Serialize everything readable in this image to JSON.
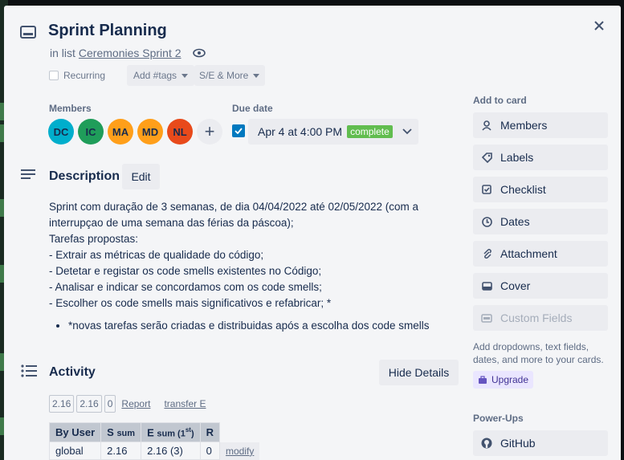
{
  "card": {
    "title": "Sprint Planning",
    "in_list_prefix": "in list",
    "list_name": "Ceremonies Sprint 2"
  },
  "toolbar": {
    "recurring_label": "Recurring",
    "tags_label": "Add #tags",
    "se_label": "S/E & More"
  },
  "members": {
    "label": "Members",
    "avatars": [
      {
        "initials": "DC",
        "color": "#00aecc"
      },
      {
        "initials": "IC",
        "color": "#1f9d5a"
      },
      {
        "initials": "MA",
        "color": "#ff9f1a"
      },
      {
        "initials": "MD",
        "color": "#ff9f1a"
      },
      {
        "initials": "NL",
        "color": "#e84a1b"
      }
    ],
    "add_label": "+"
  },
  "due": {
    "label": "Due date",
    "value": "Apr 4 at 4:00 PM",
    "badge": "complete",
    "checked": true
  },
  "description": {
    "title": "Description",
    "edit_label": "Edit",
    "lines": [
      "Sprint com duração de 3 semanas, de dia 04/04/2022 até 02/05/2022 (com a interrupçao de uma semana das férias da páscoa);",
      "Tarefas propostas:",
      "- Extrair as métricas de qualidade do código;",
      "- Detetar e registar os code smells existentes no Código;",
      "- Analisar e indicar se concordamos com os code smells;",
      "- Escolher os code smells mais significativos e refabricar; *"
    ],
    "bullet": "*novas tarefas serão criadas e distribuidas após a escolha dos code smells"
  },
  "activity": {
    "title": "Activity",
    "hide_label": "Hide Details",
    "plus_values": [
      "2.16",
      "2.16",
      "0"
    ],
    "report_label": "Report",
    "transfer_label": "transfer E",
    "table": {
      "headers": [
        "By User",
        "S sum",
        "E sum (1st)",
        "R"
      ],
      "header_parts": {
        "s_main": "S",
        "s_sub": "sum",
        "e_main": "E",
        "e_sub": "sum (1",
        "e_sup": "st",
        "e_end": ")"
      },
      "rows": [
        [
          "global",
          "2.16",
          "2.16 (3)",
          "0"
        ]
      ],
      "modify_label": "modify"
    }
  },
  "sidebar": {
    "add_to_card_label": "Add to card",
    "buttons": [
      {
        "label": "Members",
        "icon": "person-icon"
      },
      {
        "label": "Labels",
        "icon": "tag-icon"
      },
      {
        "label": "Checklist",
        "icon": "checklist-icon"
      },
      {
        "label": "Dates",
        "icon": "clock-icon"
      },
      {
        "label": "Attachment",
        "icon": "paperclip-icon"
      },
      {
        "label": "Cover",
        "icon": "cover-icon"
      }
    ],
    "custom_fields_label": "Custom Fields",
    "hint": "Add dropdowns, text fields, dates, and more to your cards.",
    "upgrade_label": "Upgrade",
    "powerups_label": "Power-Ups",
    "github_label": "GitHub"
  }
}
